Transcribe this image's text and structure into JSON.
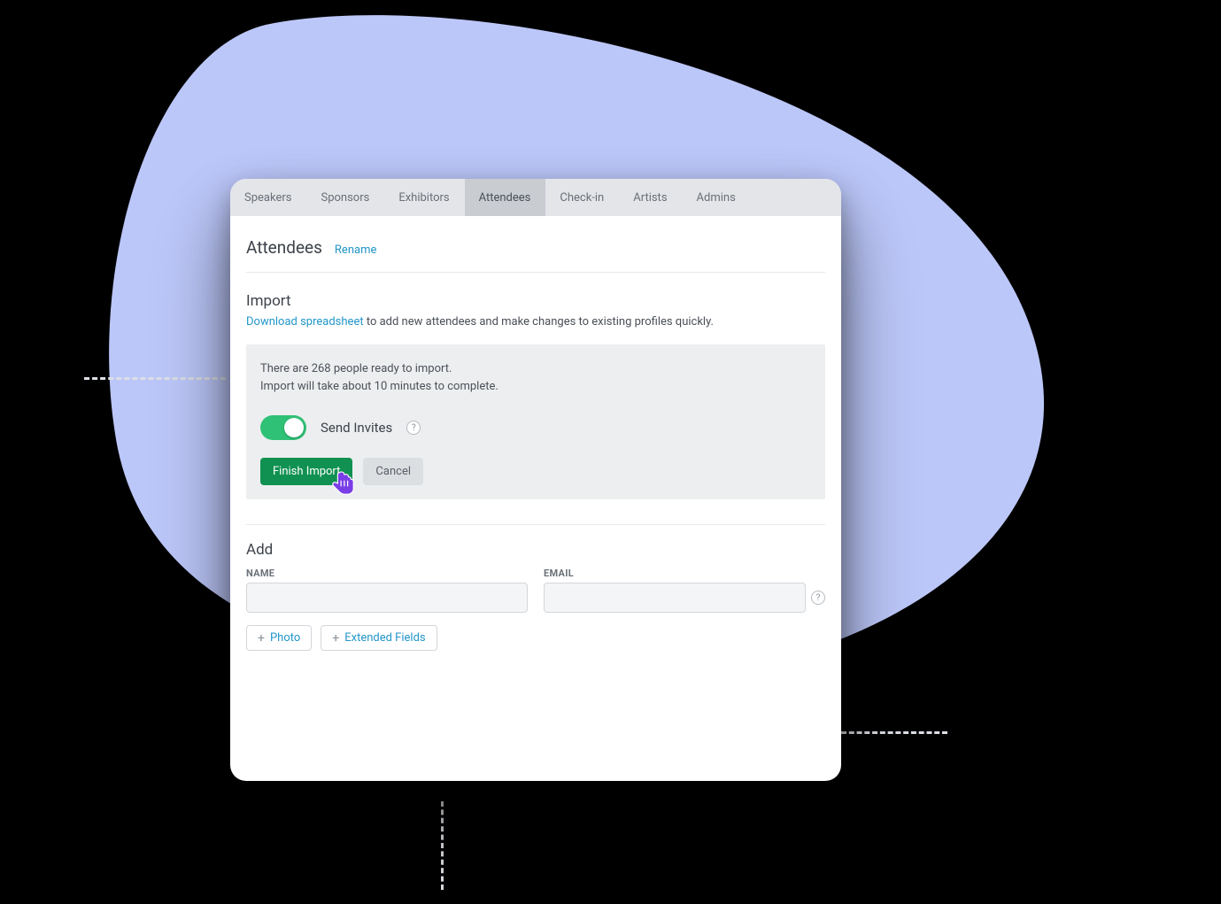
{
  "tabs": {
    "items": [
      {
        "label": "Speakers",
        "active": false
      },
      {
        "label": "Sponsors",
        "active": false
      },
      {
        "label": "Exhibitors",
        "active": false
      },
      {
        "label": "Attendees",
        "active": true
      },
      {
        "label": "Check-in",
        "active": false
      },
      {
        "label": "Artists",
        "active": false
      },
      {
        "label": "Admins",
        "active": false
      }
    ]
  },
  "header": {
    "title": "Attendees",
    "rename": "Rename"
  },
  "import": {
    "heading": "Import",
    "download_link": "Download spreadsheet",
    "download_rest": " to add new attendees and make changes to existing profiles quickly.",
    "status_line1": "There are 268 people ready to import.",
    "status_line2": "Import will take about 10 minutes to complete.",
    "send_invites_label": "Send Invites",
    "send_invites_on": true,
    "finish_button": "Finish Import",
    "cancel_button": "Cancel",
    "help_char": "?"
  },
  "add": {
    "heading": "Add",
    "name_label": "NAME",
    "email_label": "EMAIL",
    "name_value": "",
    "email_value": "",
    "photo_chip": "Photo",
    "extended_chip": "Extended Fields",
    "help_char": "?"
  },
  "colors": {
    "accent_blue": "#2396c9",
    "primary_green": "#109151",
    "toggle_green": "#2fc176",
    "blob": "#bcc7f9"
  }
}
